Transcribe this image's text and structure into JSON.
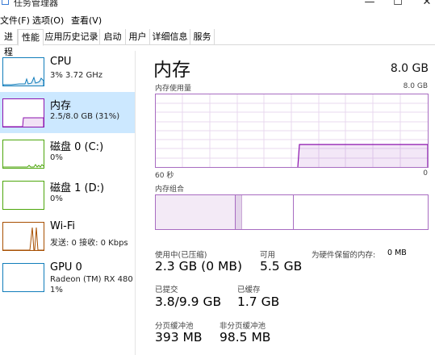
{
  "window": {
    "title": "任务管理器",
    "minimize": "—",
    "maximize": "☐",
    "close": "✕"
  },
  "menu": [
    "文件(F)",
    "选项(O)",
    "查看(V)"
  ],
  "tabs": [
    "进程",
    "性能",
    "应用历史记录",
    "启动",
    "用户",
    "详细信息",
    "服务"
  ],
  "active_tab": "性能",
  "sidebar": {
    "items": [
      {
        "title": "CPU",
        "sub1": "3% 3.72 GHz",
        "sub2": "",
        "color": "#117dbb"
      },
      {
        "title": "内存",
        "sub1": "2.5/8.0 GB (31%)",
        "sub2": "",
        "color": "#8b12ae"
      },
      {
        "title": "磁盘 0 (C:)",
        "sub1": "0%",
        "sub2": "",
        "color": "#4da60c"
      },
      {
        "title": "磁盘 1 (D:)",
        "sub1": "0%",
        "sub2": "",
        "color": "#4da60c"
      },
      {
        "title": "Wi-Fi",
        "sub1": "发送: 0 接收: 0 Kbps",
        "sub2": "",
        "color": "#a74f01"
      },
      {
        "title": "GPU 0",
        "sub1": "Radeon (TM) RX 480",
        "sub2": "1%",
        "color": "#117dbb"
      }
    ]
  },
  "memory": {
    "title": "内存",
    "total": "8.0 GB",
    "usage_label": "内存使用量",
    "usage_max": "8.0 GB",
    "time_left": "60 秒",
    "time_right": "0",
    "composition_label": "内存组合",
    "usage_fraction": 0.31,
    "stats": {
      "in_use_label": "使用中(已压缩)",
      "in_use_value": "2.3 GB (0 MB)",
      "available_label": "可用",
      "available_value": "5.5 GB",
      "reserved_label": "为硬件保留的内存:",
      "reserved_value": "0 MB",
      "committed_label": "已提交",
      "committed_value": "3.8/9.9 GB",
      "cached_label": "已缓存",
      "cached_value": "1.7 GB",
      "paged_label": "分页缓冲池",
      "paged_value": "393 MB",
      "nonpaged_label": "非分页缓冲池",
      "nonpaged_value": "98.5 MB"
    }
  }
}
